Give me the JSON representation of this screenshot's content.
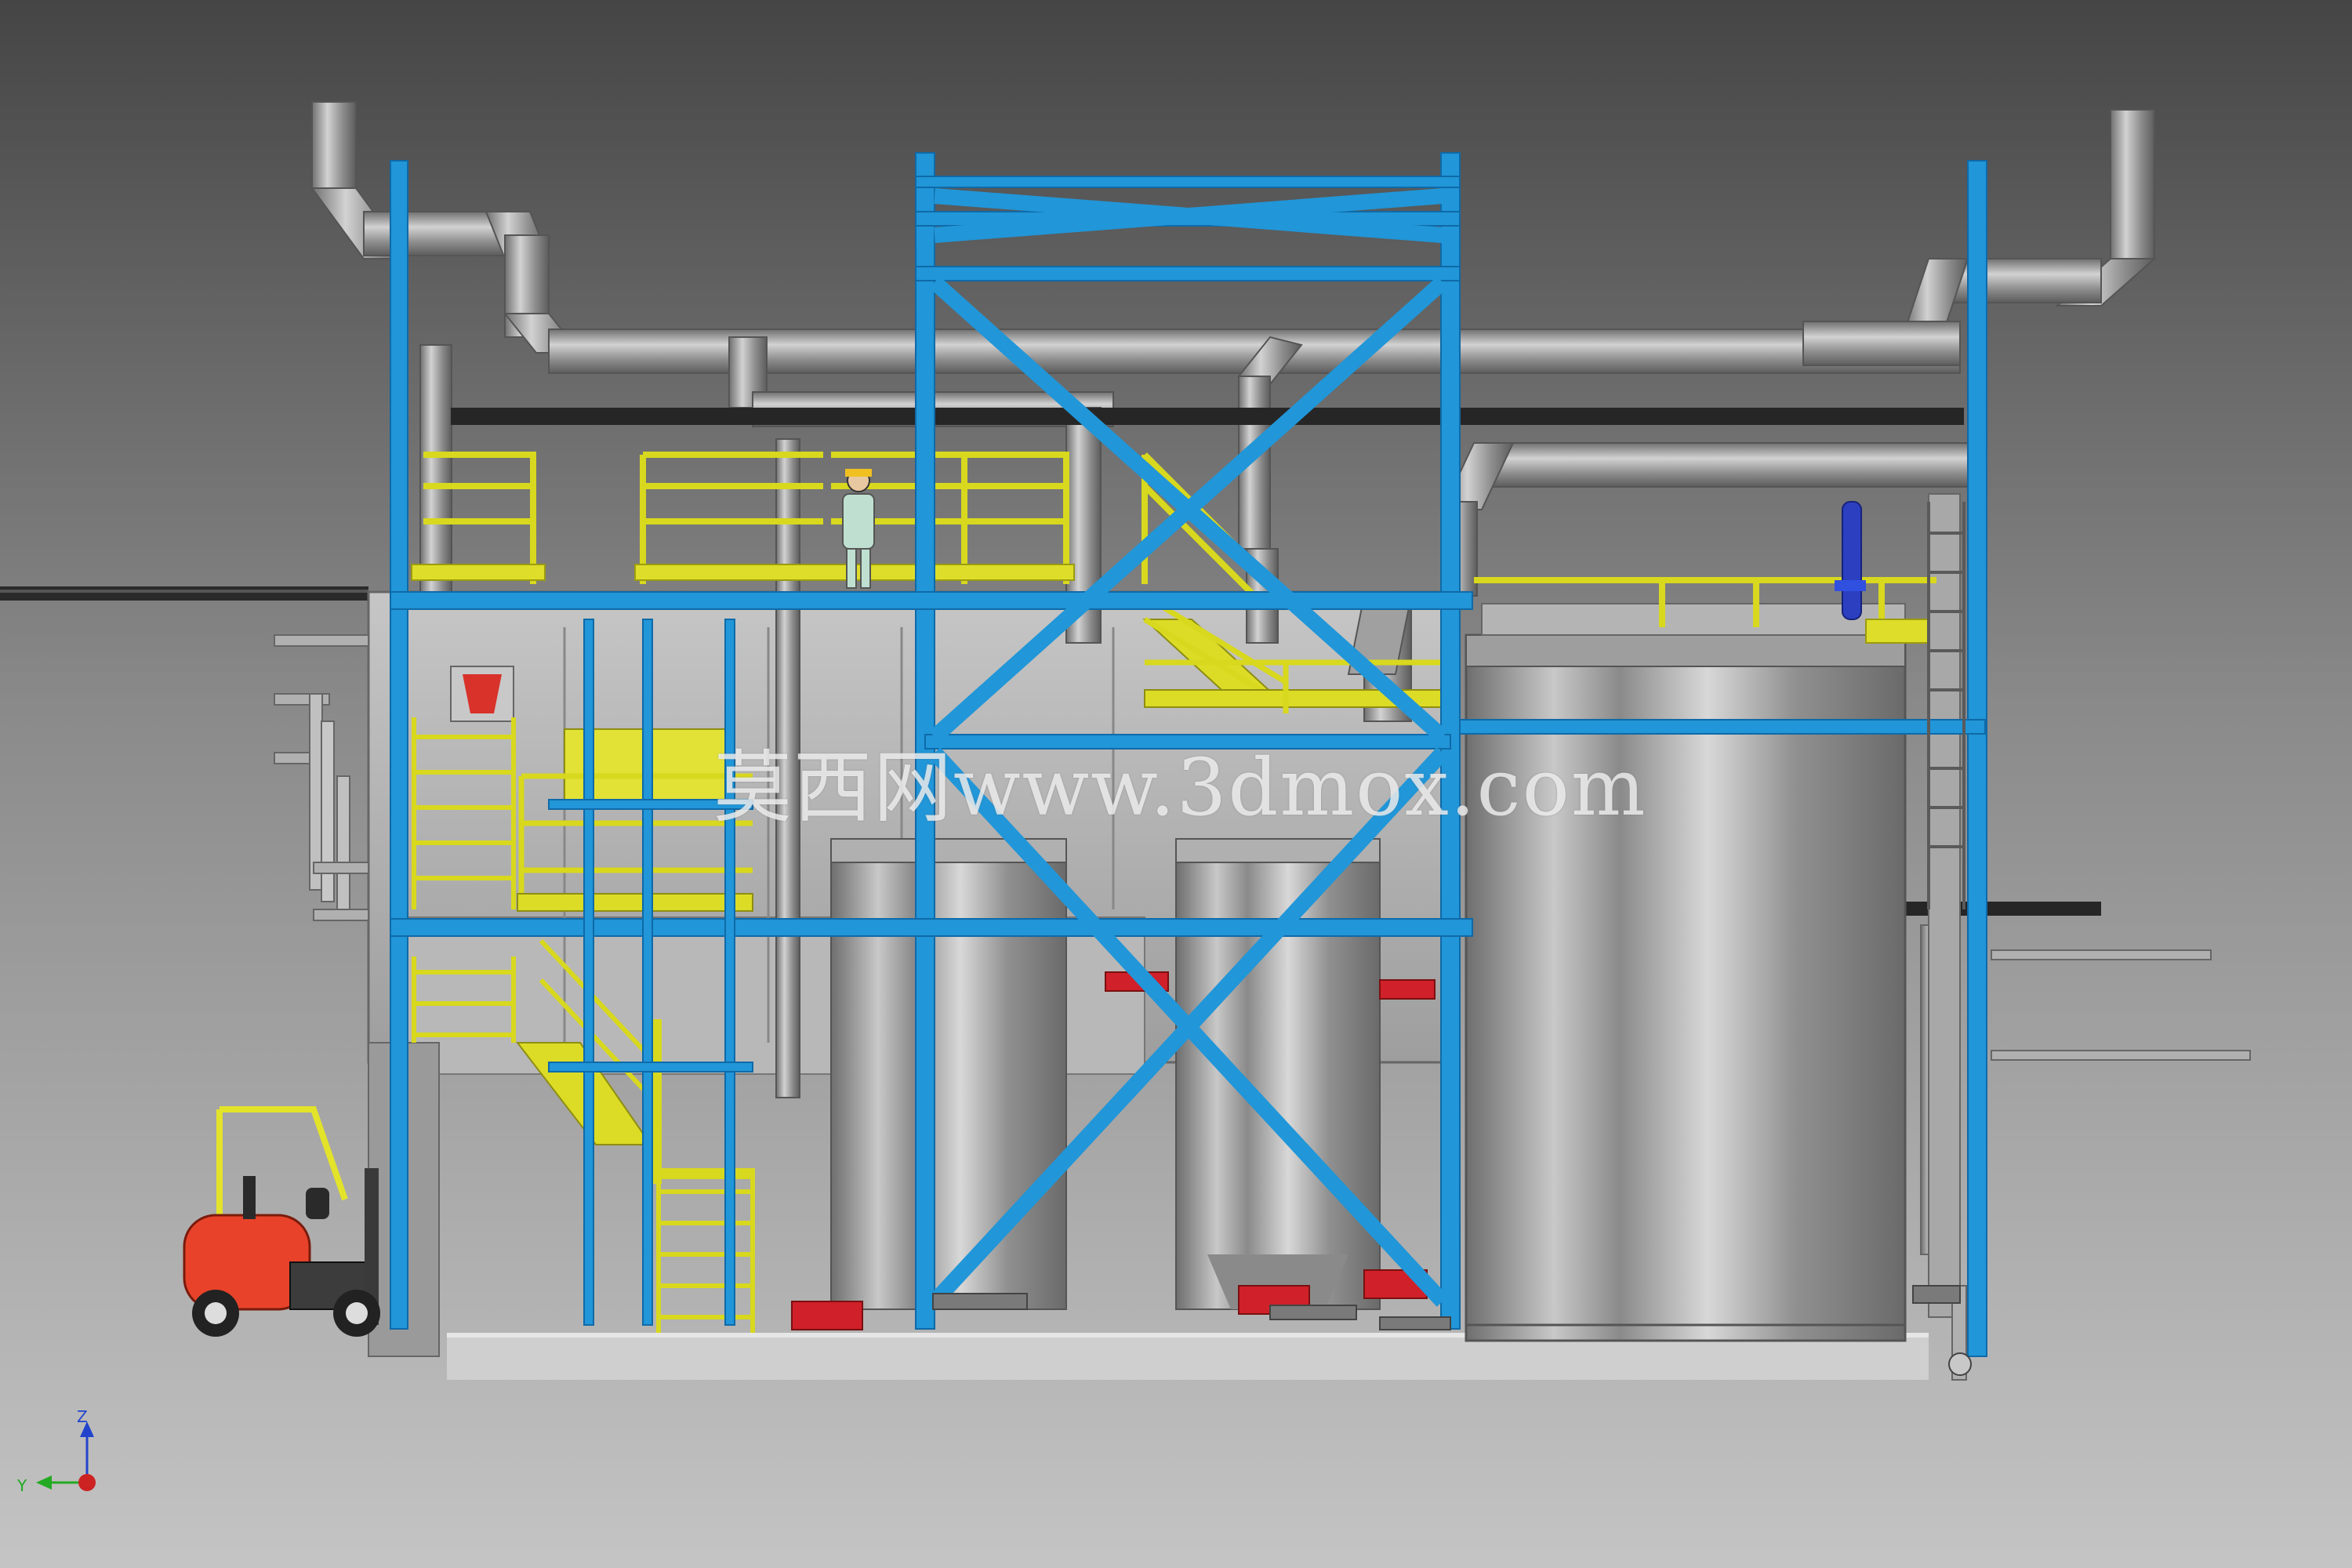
{
  "watermark": {
    "text": "莫西网www.3dmox.com"
  },
  "orientation_triad": {
    "z_label": "Z",
    "y_label": "Y",
    "colors": {
      "z": "#2244cc",
      "y": "#22aa22",
      "x": "#cc2222"
    }
  },
  "colors": {
    "background_top": "#484848",
    "background_bottom": "#c2c2c2",
    "structure_blue": "#2196d8",
    "railing_yellow": "#e0e030",
    "duct_gray": "#9c9c9c",
    "tank_steel": "#a0a0a0",
    "forklift_red": "#e8432a",
    "pump_red": "#d0202a"
  },
  "icons": [
    "forklift-icon",
    "worker-icon",
    "axis-triad-icon",
    "tank-icon"
  ]
}
